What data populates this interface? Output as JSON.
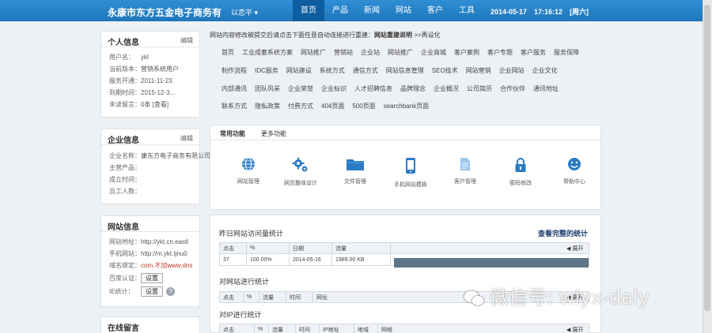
{
  "header": {
    "brand": "永康市东方五金电子商务有",
    "user_menu": "以恋平 ▾",
    "nav": [
      "首页",
      "产品",
      "新闻",
      "网站",
      "客户",
      "工具"
    ],
    "datetime": "2014-05-17　17:16:12　[周六]"
  },
  "personal": {
    "title": "个人信息",
    "edit": "编辑",
    "rows": [
      {
        "label": "用户名：",
        "value": "ykl"
      },
      {
        "label": "当前版本：",
        "value": "营销系统用户"
      },
      {
        "label": "服务开通：",
        "value": "2011-11-23"
      },
      {
        "label": "到期时间：",
        "value": "2015-12-3..."
      },
      {
        "label": "未读留言：",
        "value": "0条 [查看]"
      }
    ]
  },
  "company": {
    "title": "企业信息",
    "edit": "编辑",
    "rows": [
      {
        "label": "企业名称：",
        "value": "康东方电子商务有限公司"
      },
      {
        "label": "主营产品：",
        "value": ""
      },
      {
        "label": "成立时间：",
        "value": ""
      },
      {
        "label": "员工人数：",
        "value": ""
      }
    ]
  },
  "website": {
    "title": "网站信息",
    "rows": [
      {
        "label": "网站地址：",
        "value": "http://ykt.cn.eastl"
      },
      {
        "label": "手机网站：",
        "value": "http://m.ykt.tjnu0"
      },
      {
        "label": "域名绑定：",
        "value": "com.不加www.dns"
      },
      {
        "label": "百度认证：",
        "value": "设置"
      },
      {
        "label": "IE统计：",
        "value": "设置"
      }
    ],
    "help": "?"
  },
  "messages": {
    "title": "在线留言"
  },
  "notice": {
    "text": "网站内容修改被提交后请点击下面任意自动连接进行重建：",
    "bold": "网站重建说明",
    "link": ">>再设化"
  },
  "tags": [
    [
      "首页",
      "工业成套系统方案",
      "网站推广",
      "营销站",
      "企业站",
      "网站推广",
      "企业商城",
      "客户案例",
      "客户专题",
      "客户服务",
      "服务保障"
    ],
    [
      "制作流程",
      "IDC服务",
      "网站建设",
      "系统方式",
      "通信方式",
      "网站信息管理",
      "SEO技术",
      "网站营销",
      "企业网站",
      "企业文化"
    ],
    [
      "内部通讯",
      "团队风采",
      "企业荣誉",
      "企业标识",
      "人才招聘信息",
      "品牌理念",
      "企业概况",
      "公司简历",
      "合作伙伴",
      "通讯地址"
    ],
    [
      "联系方式",
      "隐私政策",
      "付费方式",
      "404页面",
      "500页面",
      "searchbank页面"
    ]
  ],
  "functions": {
    "tabs": [
      "常用功能",
      "更多功能"
    ],
    "tools": [
      "网站管理",
      "网页整体设计",
      "文件管理",
      "手机网站模板",
      "客户管理",
      "密码修改",
      "帮助中心"
    ]
  },
  "stats": {
    "yesterday_title": "昨日网站访问量统计",
    "full_link": "查看完整的统计",
    "yesterday_cols": [
      "点击",
      "%",
      "日期",
      "流量"
    ],
    "yesterday_row": [
      "37",
      "100.00%",
      "2014-05-16",
      "1989.00 KB"
    ],
    "visit_title": "对网站进行统计",
    "visit_cols": [
      "点击",
      "%",
      "流量",
      "时间",
      "网址"
    ],
    "ip_title": "对IP进行统计",
    "ip_cols": [
      "点击",
      "%",
      "流量",
      "时间",
      "IP地址",
      "地域",
      "网络"
    ],
    "expand": "◀ 展开"
  },
  "watermark": "微信号: wlyx-daly"
}
